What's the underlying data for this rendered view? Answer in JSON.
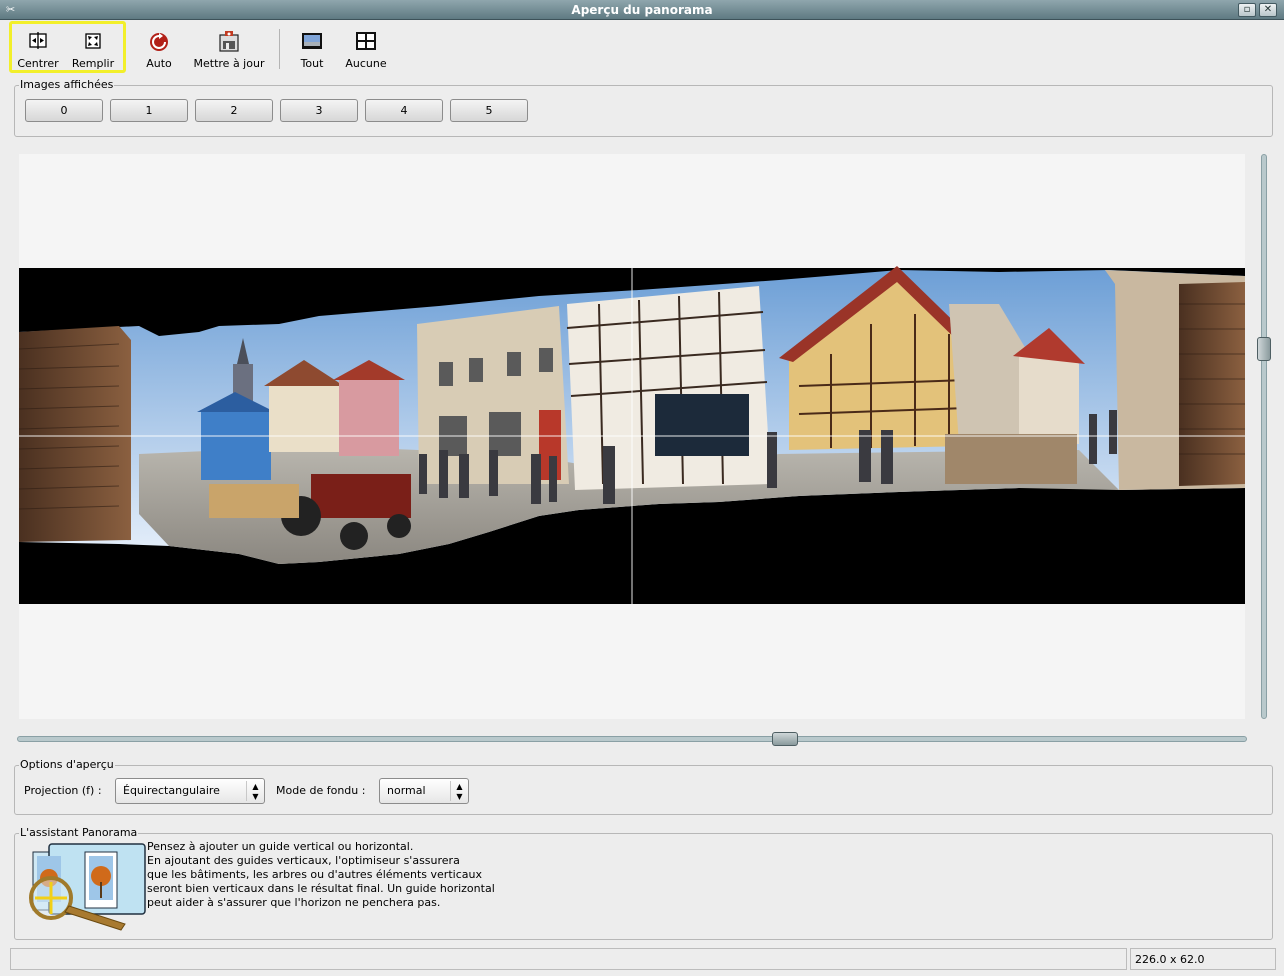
{
  "window": {
    "title": "Aperçu du panorama",
    "minimize_glyph": "▫",
    "close_glyph": "✕"
  },
  "toolbar": {
    "center_label": "Centrer",
    "fill_label": "Remplir",
    "auto_label": "Auto",
    "update_label": "Mettre à jour",
    "all_label": "Tout",
    "none_label": "Aucune"
  },
  "images_group": {
    "legend": "Images affichées",
    "buttons": [
      "0",
      "1",
      "2",
      "3",
      "4",
      "5"
    ]
  },
  "options": {
    "legend": "Options d'aperçu",
    "projection_label": "Projection (f) :",
    "projection_value": "Équirectangulaire",
    "blend_label": "Mode de fondu :",
    "blend_value": "normal"
  },
  "assistant": {
    "legend": "L'assistant Panorama",
    "text": "Pensez à ajouter un guide vertical ou horizontal.\nEn ajoutant des guides verticaux, l'optimiseur s'assurera\nque les bâtiments, les arbres ou d'autres éléments verticaux\nseront bien verticaux dans le résultat final. Un guide horizontal\npeut aider à s'assurer que l'horizon ne penchera pas."
  },
  "status": {
    "left_text": "",
    "fov_readout": "226.0 x 62.0"
  },
  "colors": {
    "titlebar": "#6f8a92",
    "highlight": "#f2ef2a",
    "panorama_background": "#000000"
  }
}
